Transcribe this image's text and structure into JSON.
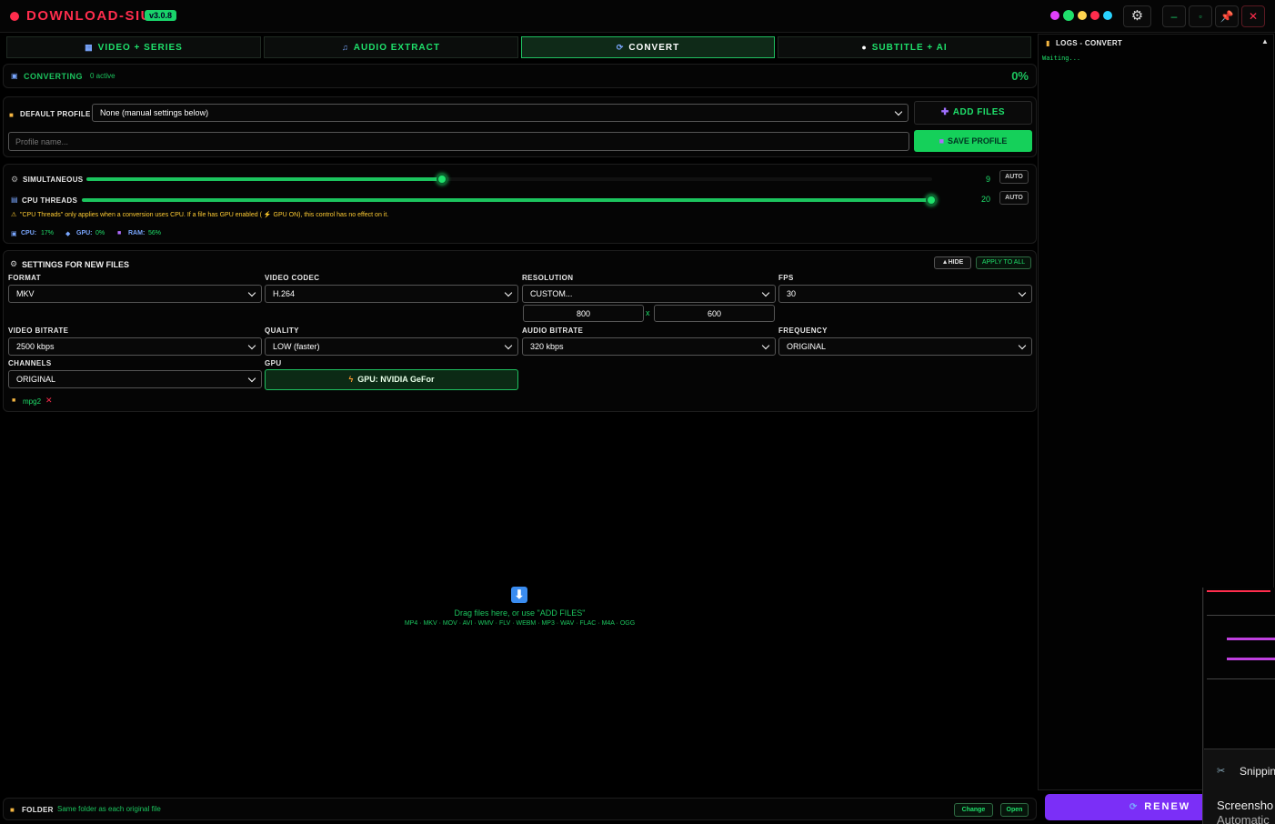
{
  "app": {
    "title": "DOWNLOAD-SIU",
    "version": "v3.0.8"
  },
  "theme": {
    "accent": "#1fe06b",
    "brand": "#ff2d4d",
    "renew": "#7b2ff7",
    "dots": [
      "#e040fb",
      "#1fe06b",
      "#ffd54f",
      "#ff2d4d",
      "#29d3ff"
    ]
  },
  "window_controls": {
    "settings_icon": "gear-icon",
    "minimize": "minimize-icon",
    "maximize": "maximize-icon",
    "pin": "pin-icon",
    "close": "close-icon"
  },
  "tabs": [
    {
      "label": "VIDEO + SERIES",
      "icon": "film-icon"
    },
    {
      "label": "AUDIO EXTRACT",
      "icon": "music-icon"
    },
    {
      "label": "CONVERT",
      "icon": "convert-icon",
      "active": true
    },
    {
      "label": "SUBTITLE + AI",
      "icon": "chat-icon"
    }
  ],
  "status": {
    "label": "CONVERTING",
    "active": "0 active",
    "percent": "0%"
  },
  "profile": {
    "label": "DEFAULT PROFILE",
    "selected": "None (manual settings below)",
    "add_files": "ADD FILES",
    "name_placeholder": "Profile name...",
    "save": "SAVE PROFILE"
  },
  "resources": {
    "simultaneous": {
      "label": "SIMULTANEOUS",
      "value": "9",
      "level": 0.42,
      "auto": "AUTO"
    },
    "cpu_threads": {
      "label": "CPU THREADS",
      "value": "20",
      "level": 1.0,
      "auto": "AUTO"
    },
    "warning": "\"CPU Threads\" only applies when a conversion uses CPU. If a file has GPU enabled ( ⚡ GPU ON), this control has no effect on it.",
    "cpu": {
      "label": "CPU:",
      "value": "17%"
    },
    "gpu": {
      "label": "GPU:",
      "value": "0%"
    },
    "ram": {
      "label": "RAM:",
      "value": "56%"
    }
  },
  "settings": {
    "title": "SETTINGS FOR NEW FILES",
    "hide": "HIDE",
    "apply_all": "APPLY TO ALL",
    "format": {
      "label": "FORMAT",
      "value": "MKV"
    },
    "video_codec": {
      "label": "VIDEO CODEC",
      "value": "H.264"
    },
    "resolution": {
      "label": "RESOLUTION",
      "value": "CUSTOM...",
      "width": "800",
      "height": "600",
      "separator": "x"
    },
    "fps": {
      "label": "FPS",
      "value": "30"
    },
    "video_bitrate": {
      "label": "VIDEO BITRATE",
      "value": "2500 kbps"
    },
    "quality": {
      "label": "QUALITY",
      "value": "LOW (faster)"
    },
    "audio_bitrate": {
      "label": "AUDIO BITRATE",
      "value": "320 kbps"
    },
    "frequency": {
      "label": "FREQUENCY",
      "value": "ORIGINAL"
    },
    "channels": {
      "label": "CHANNELS",
      "value": "ORIGINAL"
    },
    "gpu": {
      "label": "GPU",
      "value": "GPU: NVIDIA GeFor"
    },
    "tag": "mpg2"
  },
  "dropzone": {
    "text": "Drag files here, or use \"ADD FILES\"",
    "formats": "MP4 · MKV · MOV · AVI · WMV · FLV · WEBM · MP3 · WAV · FLAC · M4A · OGG"
  },
  "folder": {
    "label": "FOLDER",
    "value": "Same folder as each original file",
    "change": "Change",
    "open": "Open"
  },
  "logs": {
    "title": "LOGS - CONVERT",
    "text": "Waiting..."
  },
  "renew": "RENEW",
  "snipping": {
    "title": "Snippin",
    "body1": "Screensho",
    "body2": "Automatic"
  }
}
